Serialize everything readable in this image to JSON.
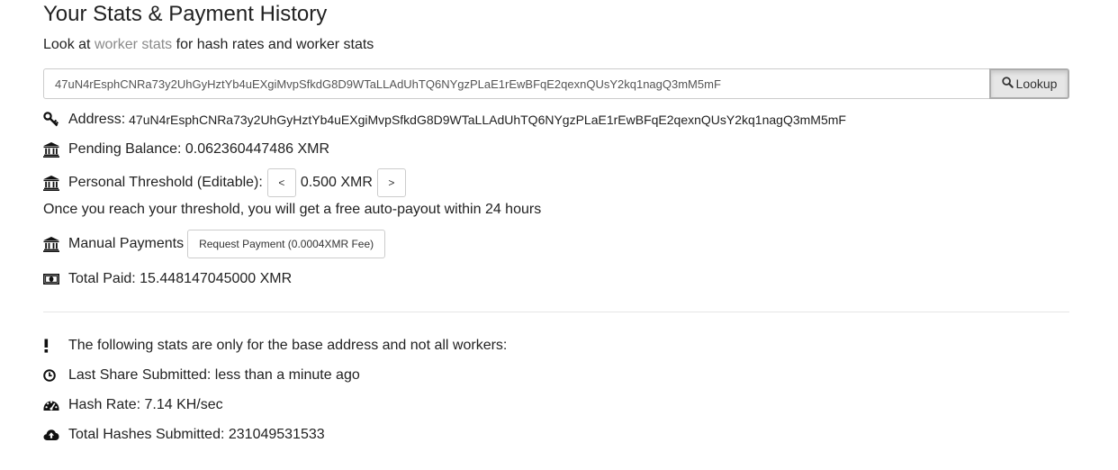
{
  "header": {
    "title": "Your Stats & Payment History",
    "subtitle_prefix": "Look at",
    "subtitle_link": "worker stats",
    "subtitle_suffix": "for hash rates and worker stats"
  },
  "lookup": {
    "input_value": "47uN4rEsphCNRa73y2UhGyHztYb4uEXgiMvpSfkdG8D9WTaLLAdUhTQ6NYgzPLaE1rEwBFqE2qexnQUsY2kq1nagQ3mM5mF",
    "button_label": "Lookup",
    "button_icon": "search-icon"
  },
  "stats": {
    "address_label": "Address:",
    "address_value": "47uN4rEsphCNRa73y2UhGyHztYb4uEXgiMvpSfkdG8D9WTaLLAdUhTQ6NYgzPLaE1rEwBFqE2qexnQUsY2kq1nagQ3mM5mF",
    "pending_balance": "Pending Balance: 0.062360447486 XMR",
    "threshold_label": "Personal Threshold (Editable):",
    "threshold_decrease": "<",
    "threshold_value": "0.500 XMR",
    "threshold_increase": ">",
    "threshold_note": "Once you reach your threshold, you will get a free auto-payout within 24 hours",
    "manual_payments_label": "Manual Payments",
    "request_payment_button": "Request Payment (0.0004XMR Fee)",
    "total_paid": "Total Paid: 15.448147045000 XMR"
  },
  "base_stats": {
    "notice": "The following stats are only for the base address and not all workers:",
    "last_share": "Last Share Submitted: less than a minute ago",
    "hash_rate": "Hash Rate: 7.14 KH/sec",
    "total_hashes": "Total Hashes Submitted: 231049531533"
  },
  "icons": {
    "address": "key-icon",
    "pending": "bank-icon",
    "threshold": "bank-icon",
    "manual": "bank-icon",
    "paid": "money-icon",
    "notice": "exclamation-icon",
    "last_share": "clock-icon",
    "hash_rate": "dashboard-icon",
    "total_hashes": "cloud-upload-icon"
  },
  "colors": {
    "link": "#8a8a8a",
    "text": "#222222",
    "border": "#cccccc"
  }
}
